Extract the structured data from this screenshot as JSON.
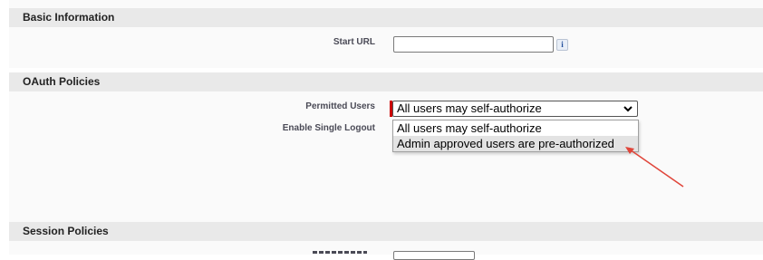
{
  "sections": {
    "basic_information": {
      "title": "Basic Information",
      "start_url": {
        "label": "Start URL",
        "value": "",
        "info": "i"
      }
    },
    "oauth_policies": {
      "title": "OAuth Policies",
      "permitted_users": {
        "label": "Permitted Users",
        "selected": "All users may self-authorize",
        "options": [
          "All users may self-authorize",
          "Admin approved users are pre-authorized"
        ]
      },
      "single_logout": {
        "label": "Enable Single Logout"
      }
    },
    "session_policies": {
      "title": "Session Policies"
    }
  },
  "colors": {
    "required": "#cc0000",
    "annotation_arrow": "#e0453a",
    "section_header": "#e9e9e9"
  },
  "icons": {
    "select_toggle": "chevron-down-icon",
    "annotation": "arrow-annotation"
  }
}
